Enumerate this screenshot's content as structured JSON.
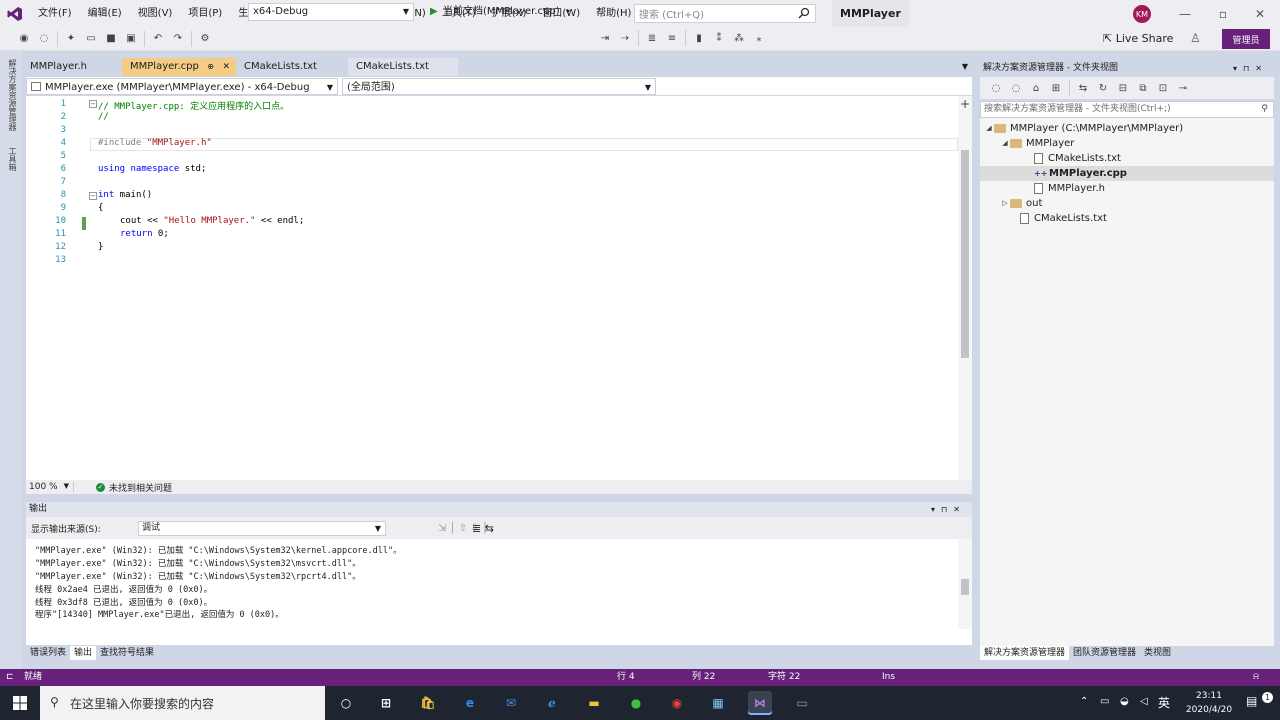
{
  "menu": [
    "文件(F)",
    "编辑(E)",
    "视图(V)",
    "项目(P)",
    "生成(B)",
    "调试(D)",
    "测试(S)",
    "分析(N)",
    "工具(T)",
    "扩展(X)",
    "窗口(W)",
    "帮助(H)"
  ],
  "search": {
    "placeholder": "搜索 (Ctrl+Q)"
  },
  "app_title": "MMPlayer",
  "avatar_initials": "KM",
  "toolbar": {
    "config": "x64-Debug",
    "run_target": "当前文档(MMPlayer.cpp)",
    "live_share": "Live Share",
    "admin": "管理员"
  },
  "left_strip": {
    "tab1": "解决方案资源管理器",
    "tab2": "工具箱"
  },
  "tabs": [
    {
      "label": "MMPlayer.h",
      "active": false
    },
    {
      "label": "MMPlayer.cpp",
      "active": true,
      "pin": "⊕",
      "close": "✕"
    },
    {
      "label": "CMakeLists.txt",
      "active": false
    },
    {
      "label": "CMakeLists.txt",
      "active": false
    }
  ],
  "navbar": {
    "target": "MMPlayer.exe (MMPlayer\\MMPlayer.exe) - x64-Debug",
    "scope": "(全局范围)"
  },
  "code": {
    "line_numbers": [
      "1",
      "2",
      "3",
      "4",
      "5",
      "6",
      "7",
      "8",
      "9",
      "10",
      "11",
      "12",
      "13"
    ],
    "l1": "// MMPlayer.cpp: 定义应用程序的入口点。",
    "l2": "//",
    "l4_pre": "#include ",
    "l4_str": "\"MMPlayer.h\"",
    "l6_kw": "using namespace",
    "l6_rest": " std;",
    "l8_kw": "int",
    "l8_rest": " main()",
    "l9": "{",
    "l10_a": "cout << ",
    "l10_str": "\"Hello MMPlayer.\"",
    "l10_b": " << endl;",
    "l11_kw": "return",
    "l11_rest": " 0;",
    "l12": "}"
  },
  "editor_status": {
    "zoom": "100 %",
    "issues": "未找到相关问题"
  },
  "output": {
    "title": "输出",
    "source_label": "显示输出来源(S):",
    "source_value": "调试",
    "lines": [
      "\"MMPlayer.exe\" (Win32): 已加载 \"C:\\Windows\\System32\\kernel.appcore.dll\"。",
      "\"MMPlayer.exe\" (Win32): 已加载 \"C:\\Windows\\System32\\msvcrt.dll\"。",
      "\"MMPlayer.exe\" (Win32): 已加载 \"C:\\Windows\\System32\\rpcrt4.dll\"。",
      "线程 0x2ae4 已退出, 返回值为 0 (0x0)。",
      "线程 0x3df8 已退出, 返回值为 0 (0x0)。",
      "程序\"[14340] MMPlayer.exe\"已退出, 返回值为 0 (0x0)。"
    ]
  },
  "bottom_tabs": [
    "错误列表",
    "输出",
    "查找符号结果"
  ],
  "solution_explorer": {
    "title": "解决方案资源管理器 - 文件夹视图",
    "search_placeholder": "搜索解决方案资源管理器 - 文件夹视图(Ctrl+;)",
    "tree": {
      "root": "MMPlayer (C:\\MMPlayer\\MMPlayer)",
      "project": "MMPlayer",
      "file1": "CMakeLists.txt",
      "file2": "MMPlayer.cpp",
      "file3": "MMPlayer.h",
      "out": "out",
      "root_file": "CMakeLists.txt"
    },
    "tabs": [
      "解决方案资源管理器",
      "团队资源管理器",
      "类视图"
    ]
  },
  "statusbar": {
    "ready": "就绪",
    "line": "行 4",
    "col": "列 22",
    "char": "字符 22",
    "ins": "Ins"
  },
  "taskbar": {
    "search_placeholder": "在这里输入你要搜索的内容",
    "ime": "英",
    "time": "23:11",
    "date": "2020/4/20",
    "notif_count": "1"
  },
  "colors": {
    "accent": "#68217a",
    "tab_active": "#f5cc84",
    "keyword": "#0000ff",
    "string": "#a31515",
    "comment": "#008000"
  }
}
